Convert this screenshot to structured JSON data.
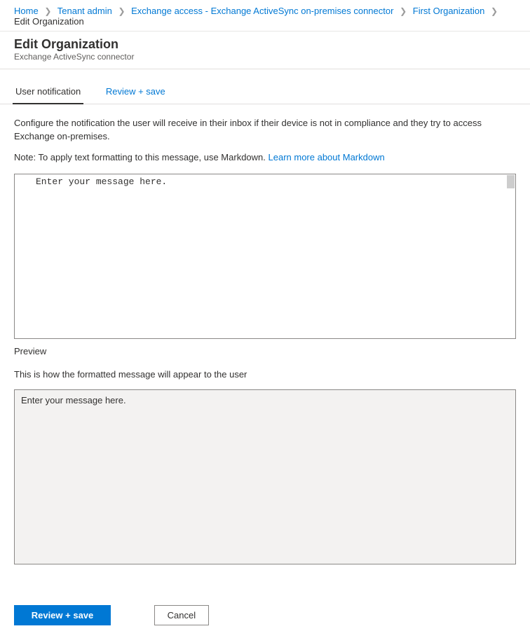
{
  "breadcrumb": {
    "items": [
      {
        "label": "Home"
      },
      {
        "label": "Tenant admin"
      },
      {
        "label": "Exchange access - Exchange ActiveSync on-premises connector"
      },
      {
        "label": "First Organization"
      }
    ],
    "current": "Edit Organization"
  },
  "header": {
    "title": "Edit Organization",
    "subtitle": "Exchange ActiveSync connector"
  },
  "tabs": {
    "items": [
      {
        "label": "User notification",
        "active": true
      },
      {
        "label": "Review + save",
        "active": false
      }
    ]
  },
  "main": {
    "description": "Configure the notification the user will receive in their inbox if their device is not in compliance and they try to access Exchange on-premises.",
    "note_prefix": "Note: To apply text formatting to this message, use Markdown. ",
    "note_link": "Learn more about Markdown",
    "textarea_placeholder": "Enter your message here.",
    "preview_label": "Preview",
    "preview_description": "This is how the formatted message will appear to the user",
    "preview_content": "Enter your message here."
  },
  "footer": {
    "primary_label": "Review + save",
    "cancel_label": "Cancel"
  }
}
